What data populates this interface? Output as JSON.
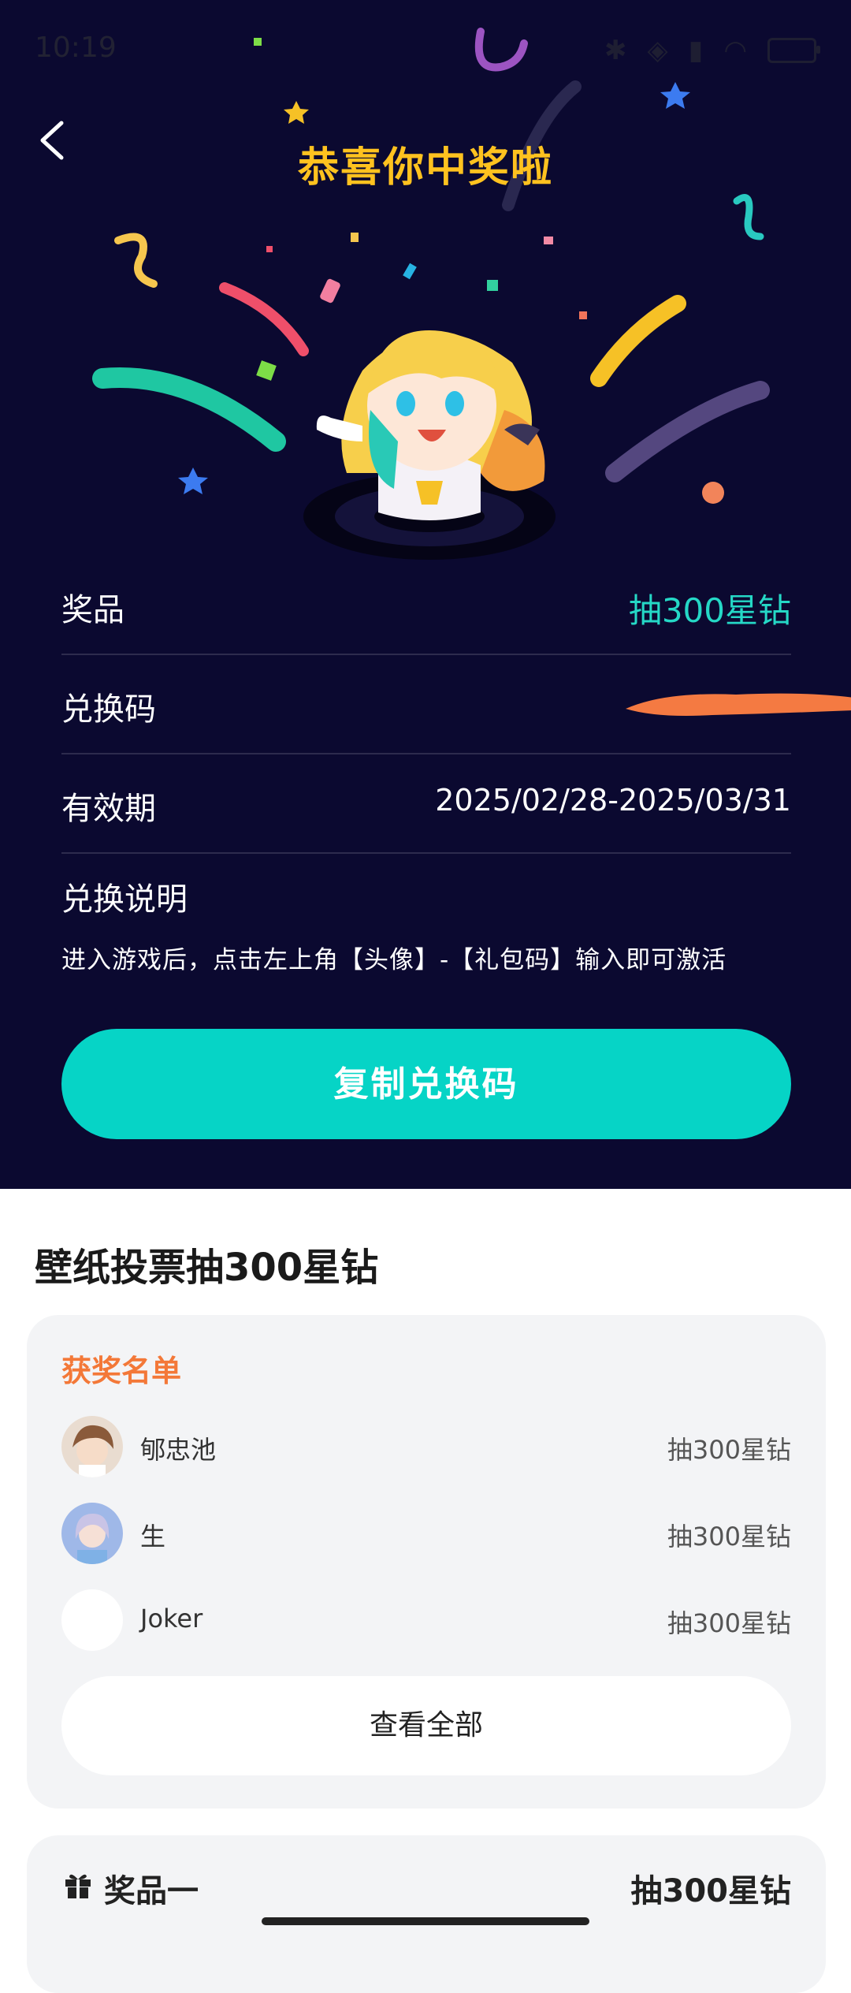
{
  "status_bar": {
    "time": "10:19"
  },
  "header": {
    "title": "恭喜你中奖啦"
  },
  "details": {
    "prize_label": "奖品",
    "prize_value": "抽300星钻",
    "code_label": "兑换码",
    "validity_label": "有效期",
    "validity_value": "2025/02/28-2025/03/31",
    "instruction_label": "兑换说明",
    "instruction_text": "进入游戏后，点击左上角【头像】-【礼包码】输入即可激活"
  },
  "copy_button_label": "复制兑换码",
  "activity": {
    "title": "壁纸投票抽300星钻",
    "winners_title": "获奖名单",
    "winners": [
      {
        "name": "郇忠池",
        "prize": "抽300星钻"
      },
      {
        "name": "生",
        "prize": "抽300星钻"
      },
      {
        "name": "Joker",
        "prize": "抽300星钻"
      }
    ],
    "view_all_label": "查看全部"
  },
  "prize_card": {
    "label": "奖品一",
    "value": "抽300星钻"
  },
  "colors": {
    "background": "#0b0930",
    "accent": "#06d4c6",
    "title": "#ffc21f",
    "winners_title": "#f37838"
  }
}
